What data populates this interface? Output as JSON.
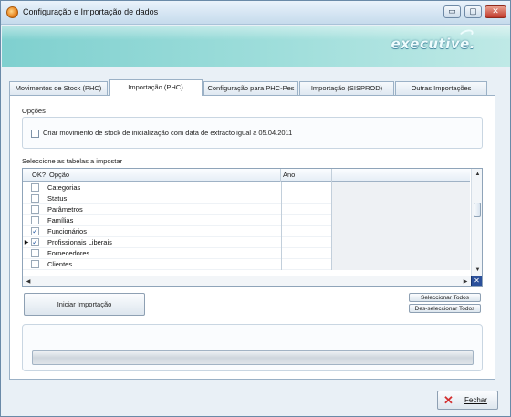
{
  "window": {
    "title": "Configuração e Importação de dados",
    "controls": {
      "minimize": "▭",
      "maximize": "▢",
      "close": "✕"
    }
  },
  "banner": {
    "logo_text": "executive."
  },
  "tabs": [
    {
      "label": "Movimentos de Stock (PHC)",
      "active": false
    },
    {
      "label": "Importação (PHC)",
      "active": true
    },
    {
      "label": "Configuração para PHC-Pes",
      "active": false
    },
    {
      "label": "Importação (SISPROD)",
      "active": false
    },
    {
      "label": "Outras Importações",
      "active": false
    }
  ],
  "options": {
    "section_label": "Opções",
    "checkbox_label": "Criar movimento de stock de inicialização com data de extracto igual a 05.04.2011",
    "checked": false
  },
  "tables": {
    "section_label": "Seleccione as tabelas a impostar",
    "columns": {
      "ok": "OK?",
      "option": "Opção",
      "year": "Ano"
    },
    "rows": [
      {
        "label": "Categorias",
        "checked": false,
        "current": false
      },
      {
        "label": "Status",
        "checked": false,
        "current": false
      },
      {
        "label": "Parâmetros",
        "checked": false,
        "current": false
      },
      {
        "label": "Famílias",
        "checked": false,
        "current": false
      },
      {
        "label": "Funcionários",
        "checked": true,
        "current": false
      },
      {
        "label": "Profissionais Liberais",
        "checked": true,
        "current": true
      },
      {
        "label": "Fornecedores",
        "checked": false,
        "current": false
      },
      {
        "label": "Clientes",
        "checked": false,
        "current": false
      }
    ]
  },
  "actions": {
    "start_import": "Iniciar Importação",
    "select_all": "Seleccionar Todos",
    "deselect_all": "Des-seleccionar Todos"
  },
  "progress": {
    "fraction": 0
  },
  "footer": {
    "exit_label": "Fechar"
  },
  "colors": {
    "banner": "#9fdedb",
    "accent": "#2a4f9a",
    "close": "#d32f2f"
  }
}
